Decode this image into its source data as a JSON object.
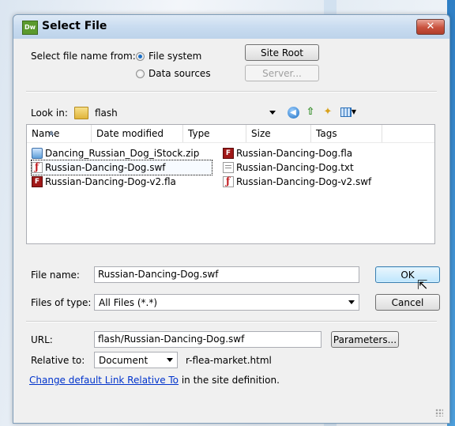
{
  "dialog": {
    "app_badge": "Dw",
    "title": "Select File",
    "close_glyph": "✕"
  },
  "source": {
    "label": "Select file name from:",
    "options": [
      {
        "label": "File system",
        "selected": true
      },
      {
        "label": "Data sources",
        "selected": false
      }
    ],
    "site_root_button": "Site Root",
    "server_button": "Server..."
  },
  "lookin": {
    "label": "Look in:",
    "folder": "flash",
    "tools": [
      "back-icon",
      "up-folder-icon",
      "new-folder-icon",
      "views-menu-icon"
    ]
  },
  "file_list": {
    "columns": [
      "Name",
      "Date modified",
      "Type",
      "Size",
      "Tags"
    ],
    "items": [
      {
        "name": "Dancing_Russian_Dog_iStock.zip",
        "icon": "zip-icon",
        "selected": false
      },
      {
        "name": "Russian-Dancing-Dog.swf",
        "icon": "swf-icon",
        "selected": true
      },
      {
        "name": "Russian-Dancing-Dog-v2.fla",
        "icon": "fla-icon",
        "selected": false
      },
      {
        "name": "Russian-Dancing-Dog.fla",
        "icon": "fla-icon",
        "selected": false
      },
      {
        "name": "Russian-Dancing-Dog.txt",
        "icon": "txt-icon",
        "selected": false
      },
      {
        "name": "Russian-Dancing-Dog-v2.swf",
        "icon": "swf-icon",
        "selected": false
      }
    ]
  },
  "filename": {
    "label": "File name:",
    "value": "Russian-Dancing-Dog.swf",
    "ok_button": "OK"
  },
  "filetype": {
    "label": "Files of type:",
    "value": "All Files (*.*)",
    "cancel_button": "Cancel"
  },
  "url": {
    "label": "URL:",
    "value": "flash/Russian-Dancing-Dog.swf",
    "parameters_button": "Parameters..."
  },
  "relative": {
    "label": "Relative to:",
    "value": "Document",
    "document_name": "r-flea-market.html"
  },
  "footer": {
    "link_text": "Change default Link Relative To",
    "suffix_text": " in the site definition."
  },
  "colors": {
    "title_gradient_top": "#dfeaf6",
    "close_red": "#c8513d",
    "link_blue": "#0033cc",
    "dialog_face": "#f0f0f0"
  }
}
